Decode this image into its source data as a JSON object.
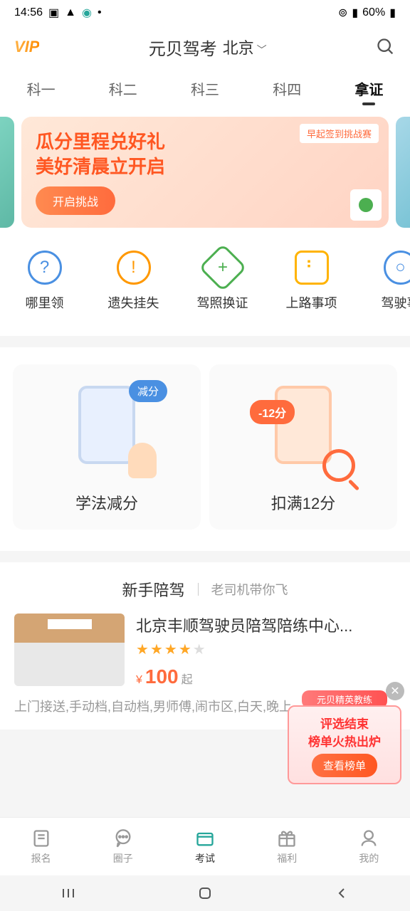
{
  "status": {
    "time": "14:56",
    "battery": "60%"
  },
  "header": {
    "vip": "VIP",
    "title": "元贝驾考",
    "location": "北京"
  },
  "tabs": [
    {
      "label": "科一"
    },
    {
      "label": "科二"
    },
    {
      "label": "科三"
    },
    {
      "label": "科四"
    },
    {
      "label": "拿证"
    }
  ],
  "banner": {
    "tag": "早起签到挑战赛",
    "line1": "瓜分里程兑好礼",
    "line2": "美好清晨立开启",
    "button": "开启挑战"
  },
  "quick_actions": [
    {
      "label": "哪里领"
    },
    {
      "label": "遗失挂失"
    },
    {
      "label": "驾照换证"
    },
    {
      "label": "上路事项"
    },
    {
      "label": "驾驶事"
    }
  ],
  "cards": [
    {
      "label": "学法减分",
      "badge": "减分"
    },
    {
      "label": "扣满12分",
      "badge": "-12分"
    }
  ],
  "section": {
    "title": "新手陪驾",
    "sub": "老司机带你飞"
  },
  "listing": {
    "title": "北京丰顺驾驶员陪驾陪练中心...",
    "currency": "¥",
    "price": "100",
    "suffix": "起",
    "tags": "上门接送,手动档,自动档,男师傅,闹市区,白天,晚上"
  },
  "float": {
    "ribbon": "元贝精英教练",
    "line1": "评选结束",
    "line2": "榜单火热出炉",
    "button": "查看榜单"
  },
  "nav": [
    {
      "label": "报名"
    },
    {
      "label": "圈子"
    },
    {
      "label": "考试"
    },
    {
      "label": "福利"
    },
    {
      "label": "我的"
    }
  ]
}
